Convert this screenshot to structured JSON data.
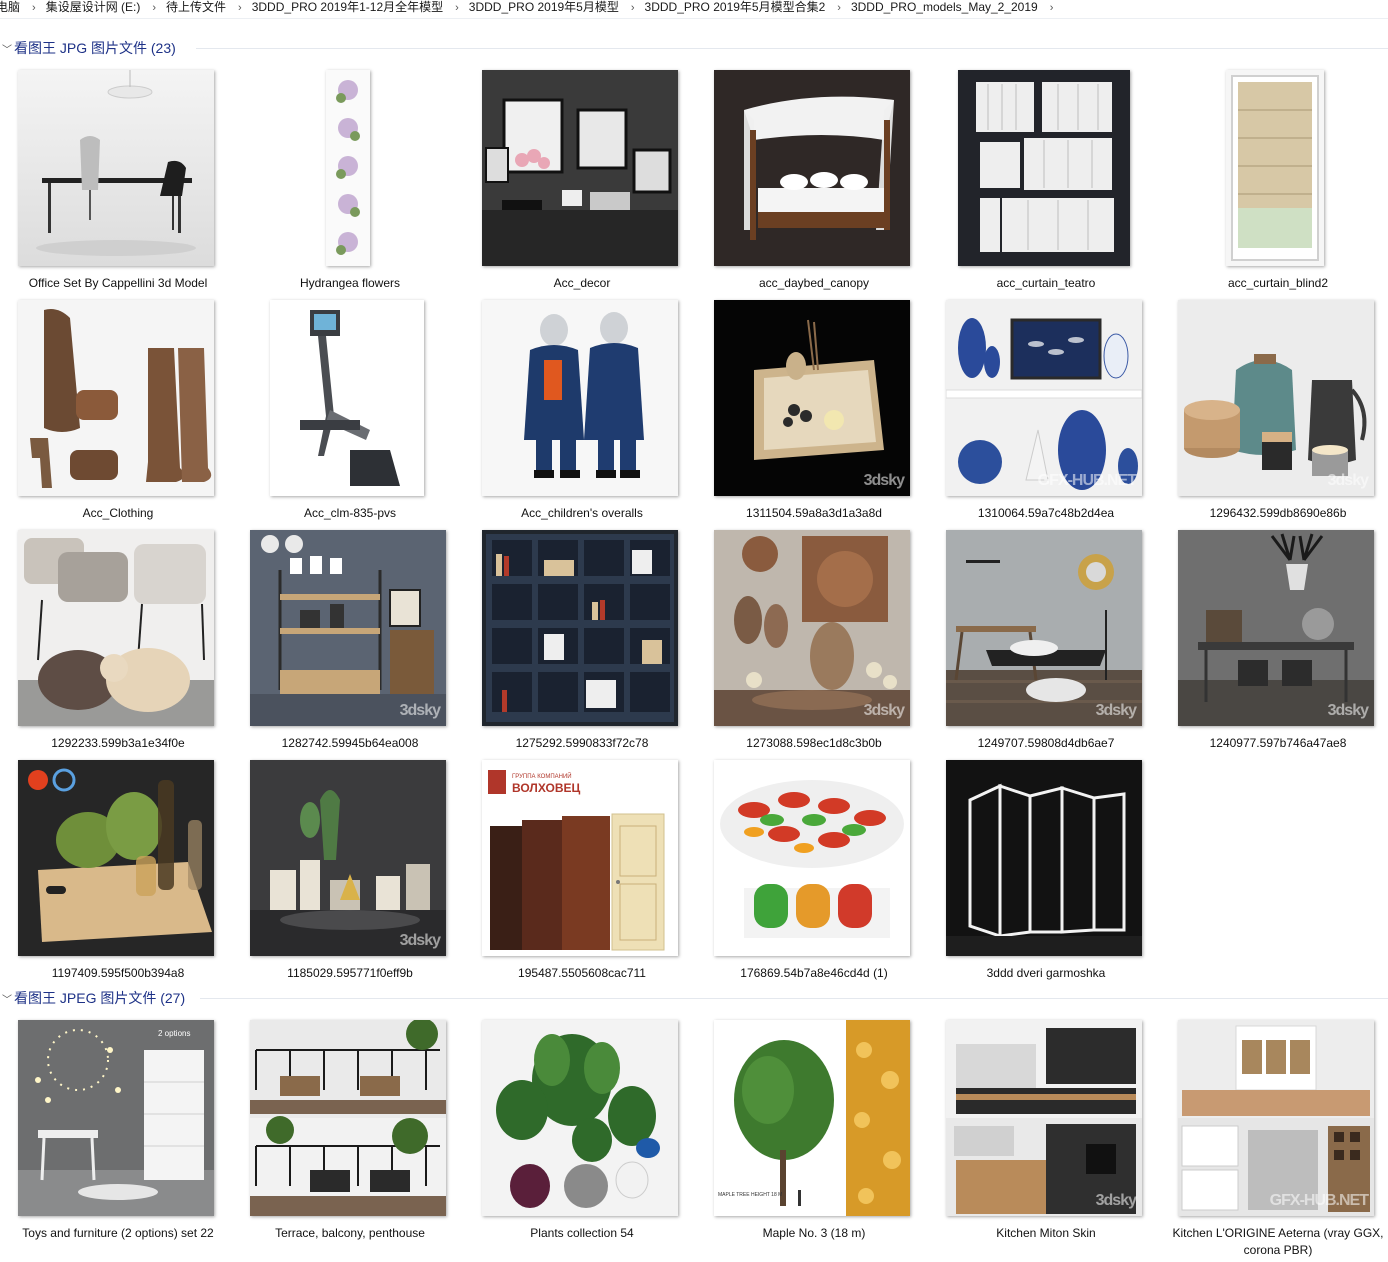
{
  "breadcrumb": [
    "电脑",
    "集设屋设计网 (E:)",
    "待上传文件",
    "3DDD_PRO 2019年1-12月全年模型",
    "3DDD_PRO 2019年5月模型",
    "3DDD_PRO 2019年5月模型合集2",
    "3DDD_PRO_models_May_2_2019"
  ],
  "groups": [
    {
      "title": "看图王 JPG 图片文件 (23)",
      "items": [
        {
          "name": "Office Set By Cappellini 3d Model"
        },
        {
          "name": "Hydrangea flowers"
        },
        {
          "name": "Acc_decor"
        },
        {
          "name": "acc_daybed_canopy"
        },
        {
          "name": "acc_curtain_teatro"
        },
        {
          "name": "acc_curtain_blind2"
        },
        {
          "name": "Acc_Clothing"
        },
        {
          "name": "Acc_clm-835-pvs"
        },
        {
          "name": "Acc_children's overalls"
        },
        {
          "name": "1311504.59a8a3d1a3a8d"
        },
        {
          "name": "1310064.59a7c48b2d4ea"
        },
        {
          "name": "1296432.599db8690e86b"
        },
        {
          "name": "1292233.599b3a1e34f0e"
        },
        {
          "name": "1282742.59945b64ea008"
        },
        {
          "name": "1275292.5990833f72c78"
        },
        {
          "name": "1273088.598ec1d8c3b0b"
        },
        {
          "name": "1249707.59808d4db6ae7"
        },
        {
          "name": "1240977.597b746a47ae8"
        },
        {
          "name": "1197409.595f500b394a8"
        },
        {
          "name": "1185029.595771f0eff9b"
        },
        {
          "name": "195487.5505608cac711"
        },
        {
          "name": "176869.54b7a8e46cd4d (1)"
        },
        {
          "name": "3ddd dveri garmoshka"
        }
      ]
    },
    {
      "title": "看图王 JPEG 图片文件 (27)",
      "items": [
        {
          "name": "Toys and furniture (2 options) set 22"
        },
        {
          "name": "Terrace, balcony, penthouse"
        },
        {
          "name": "Plants collection 54"
        },
        {
          "name": "Maple No. 3 (18 m)"
        },
        {
          "name": "Kitchen Miton Skin"
        },
        {
          "name": "Kitchen L'ORIGINE Aeterna (vray GGX, corona PBR)"
        }
      ]
    }
  ],
  "thumb_text": {
    "door_brand": "ВОЛХОВЕЦ",
    "door_brand_sub": "ГРУППА КОМПАНИЙ",
    "tree_label": "MAPLE TREE HEIGHT 18 M",
    "toys_options": "2 options",
    "wm_3dsky": "3dsky",
    "wm_gfx": "GFX-HUB.NET"
  },
  "colors": {
    "group_title": "#1e3287",
    "separator": "#e4e8ee"
  }
}
